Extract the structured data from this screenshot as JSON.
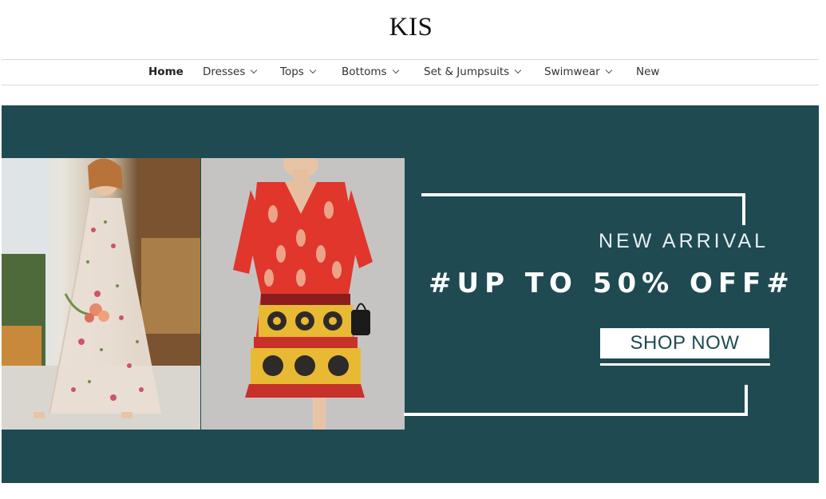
{
  "header": {
    "logo": "KIS"
  },
  "nav": {
    "items": [
      {
        "label": "Home",
        "dropdown": false,
        "active": true
      },
      {
        "label": "Dresses",
        "dropdown": true
      },
      {
        "label": "Tops",
        "dropdown": true
      },
      {
        "label": "Bottoms",
        "dropdown": true
      },
      {
        "label": "Set & Jumpsuits",
        "dropdown": true
      },
      {
        "label": "Swimwear",
        "dropdown": true
      },
      {
        "label": "New",
        "dropdown": false
      }
    ]
  },
  "banner": {
    "subtitle": "NEW ARRIVAL",
    "headline": "#UP TO 50% OFF#",
    "cta": "SHOP NOW",
    "background_color": "#1f4a52"
  }
}
